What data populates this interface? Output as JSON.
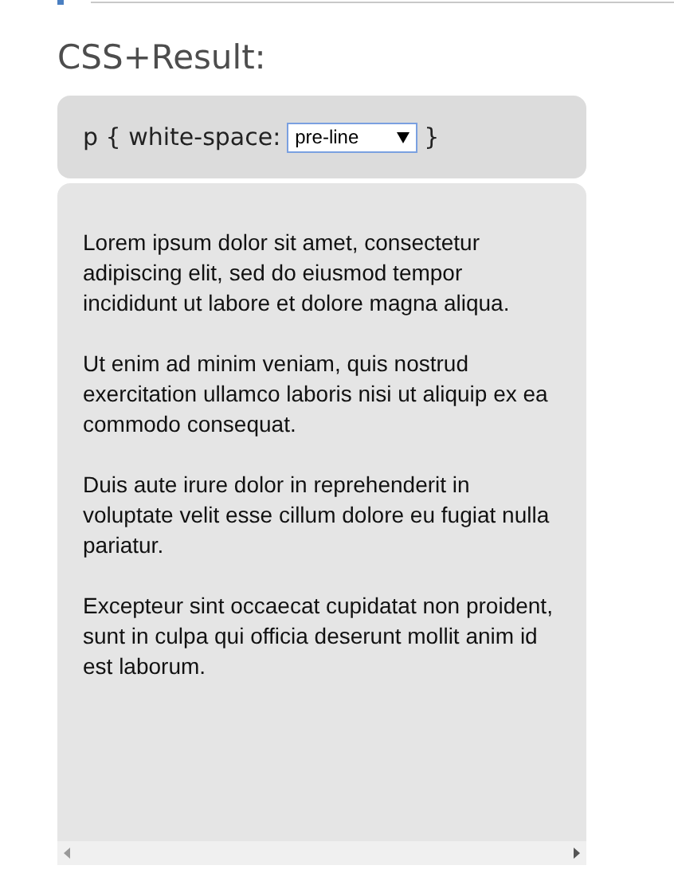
{
  "heading": "CSS+Result:",
  "css_rule": {
    "before": "p { white-space:",
    "select": {
      "value": "pre-line"
    },
    "after": "}"
  },
  "result": {
    "paragraphs": [
      "Lorem ipsum dolor sit amet, consectetur adipiscing elit, sed do eiusmod tempor incididunt ut labore et dolore magna aliqua.",
      "Ut enim ad minim veniam, quis nostrud exercitation ullamco laboris nisi ut aliquip ex ea commodo consequat.",
      "Duis aute irure dolor in reprehenderit in voluptate velit esse cillum dolore eu fugiat nulla pariatur.",
      "Excepteur sint occaecat cupidatat non proident, sunt in culpa qui officia deserunt mollit anim id est laborum."
    ]
  }
}
